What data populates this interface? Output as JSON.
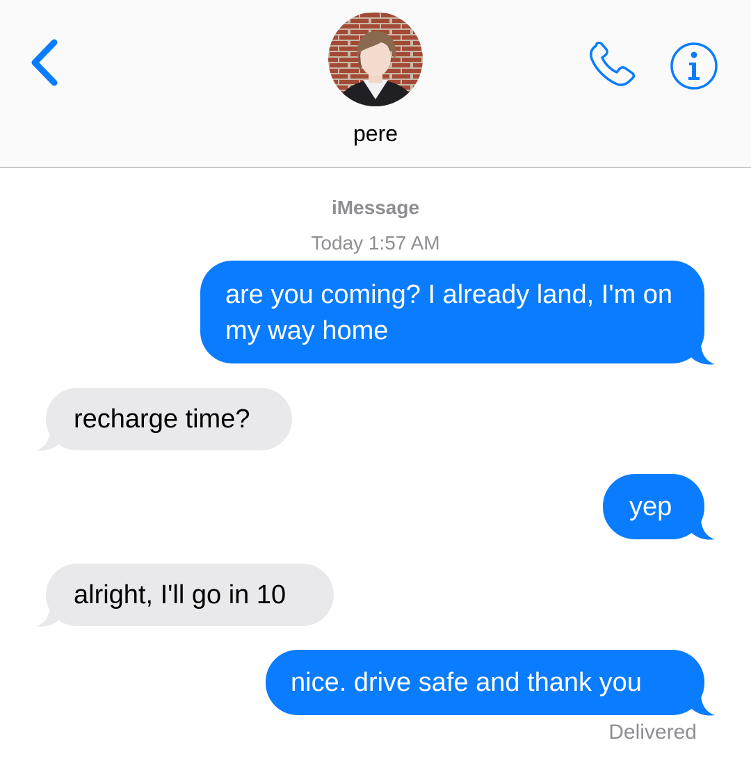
{
  "header": {
    "contact_name": "pere",
    "back_icon": "chevron-left-icon",
    "call_icon": "phone-icon",
    "info_icon": "info-icon",
    "accent_color": "#0a7cff"
  },
  "thread": {
    "service": "iMessage",
    "timestamp": "Today 1:57 AM",
    "messages": [
      {
        "direction": "outgoing",
        "text": "are you coming? I already land, I'm on my way home"
      },
      {
        "direction": "incoming",
        "text": "recharge time?"
      },
      {
        "direction": "outgoing",
        "text": "yep"
      },
      {
        "direction": "incoming",
        "text": "alright, I'll go in 10"
      },
      {
        "direction": "outgoing",
        "text": "nice. drive safe and thank you"
      }
    ],
    "status": "Delivered"
  },
  "colors": {
    "outgoing_bubble": "#0a7cff",
    "incoming_bubble": "#e9e9eb",
    "secondary_text": "#8e8e93"
  }
}
